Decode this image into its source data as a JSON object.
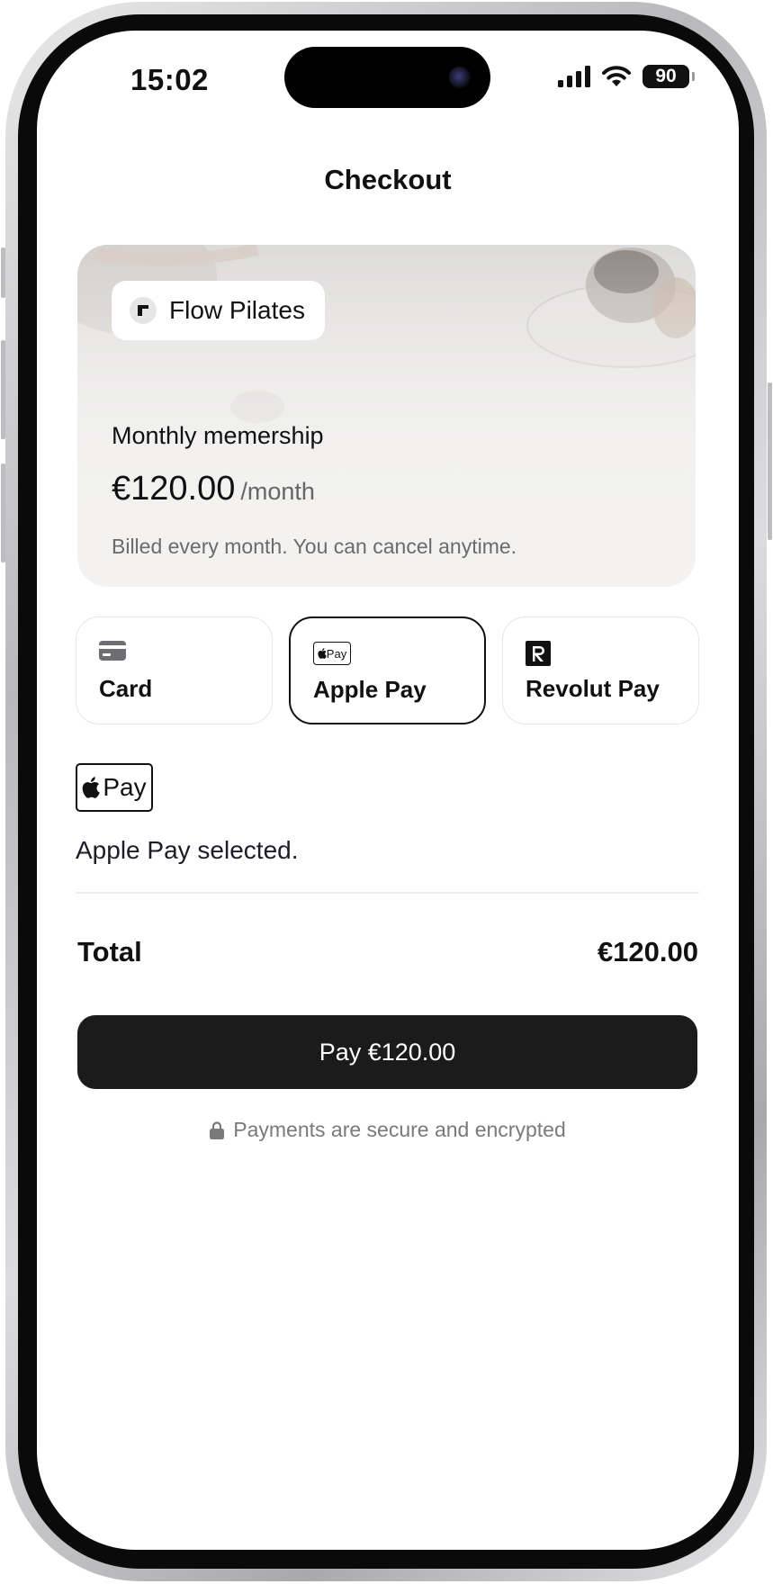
{
  "status_bar": {
    "time": "15:02",
    "battery": "90"
  },
  "header": {
    "title": "Checkout"
  },
  "product": {
    "brand": "Flow Pilates",
    "plan_name": "Monthly memership",
    "price": "€120.00",
    "period": "/month",
    "billing_note": "Billed every month. You can cancel anytime."
  },
  "payment_methods": [
    {
      "label": "Card",
      "icon": "credit-card-icon",
      "selected": false
    },
    {
      "label": "Apple Pay",
      "icon": "apple-pay-icon",
      "selected": true
    },
    {
      "label": "Revolut Pay",
      "icon": "revolut-icon",
      "selected": false
    }
  ],
  "apple_pay_mark": "Pay",
  "selection_message": "Apple Pay selected.",
  "summary": {
    "total_label": "Total",
    "total_value": "€120.00"
  },
  "pay_button": {
    "label": "Pay €120.00"
  },
  "security_note": "Payments are secure and encrypted",
  "colors": {
    "primary": "#1b1b1b",
    "muted_text": "#6b6b6b",
    "border": "#e6e6e6"
  }
}
